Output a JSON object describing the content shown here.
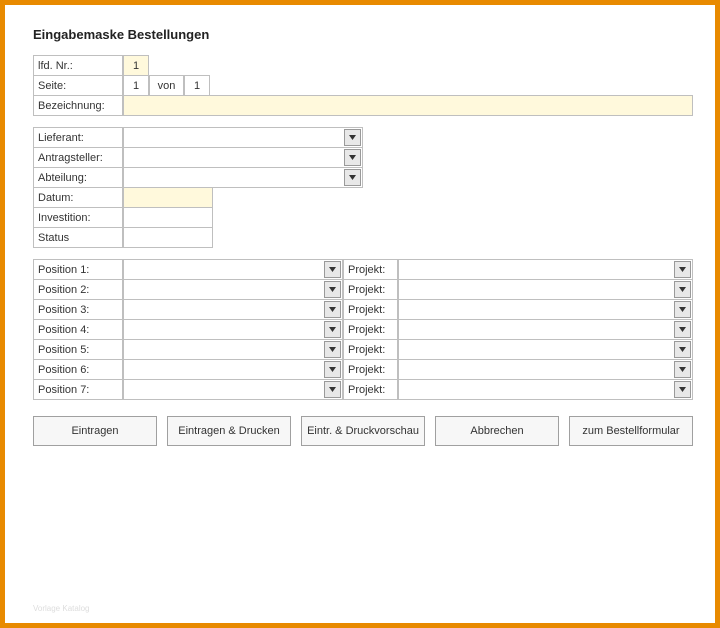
{
  "title": "Eingabemaske Bestellungen",
  "header": {
    "lfd_label": "lfd. Nr.:",
    "lfd_value": "1",
    "seite_label": "Seite:",
    "seite_value": "1",
    "von_label": "von",
    "seite_total": "1",
    "bez_label": "Bezeichnung:",
    "bez_value": ""
  },
  "mid": {
    "lieferant_label": "Lieferant:",
    "lieferant_value": "",
    "antragsteller_label": "Antragsteller:",
    "antragsteller_value": "",
    "abteilung_label": "Abteilung:",
    "abteilung_value": "",
    "datum_label": "Datum:",
    "datum_value": "",
    "investition_label": "Investition:",
    "investition_value": "",
    "status_label": "Status",
    "status_value": ""
  },
  "positions": [
    {
      "label": "Position 1:",
      "pos": "",
      "proj_label": "Projekt:",
      "proj": ""
    },
    {
      "label": "Position 2:",
      "pos": "",
      "proj_label": "Projekt:",
      "proj": ""
    },
    {
      "label": "Position 3:",
      "pos": "",
      "proj_label": "Projekt:",
      "proj": ""
    },
    {
      "label": "Position 4:",
      "pos": "",
      "proj_label": "Projekt:",
      "proj": ""
    },
    {
      "label": "Position 5:",
      "pos": "",
      "proj_label": "Projekt:",
      "proj": ""
    },
    {
      "label": "Position 6:",
      "pos": "",
      "proj_label": "Projekt:",
      "proj": ""
    },
    {
      "label": "Position 7:",
      "pos": "",
      "proj_label": "Projekt:",
      "proj": ""
    }
  ],
  "buttons": {
    "eintragen": "Eintragen",
    "eintragen_drucken": "Eintragen & Drucken",
    "eintr_vorschau": "Eintr. & Druckvorschau",
    "abbrechen": "Abbrechen",
    "zum_formular": "zum Bestellformular"
  },
  "watermark": "Vorlage Katalog"
}
